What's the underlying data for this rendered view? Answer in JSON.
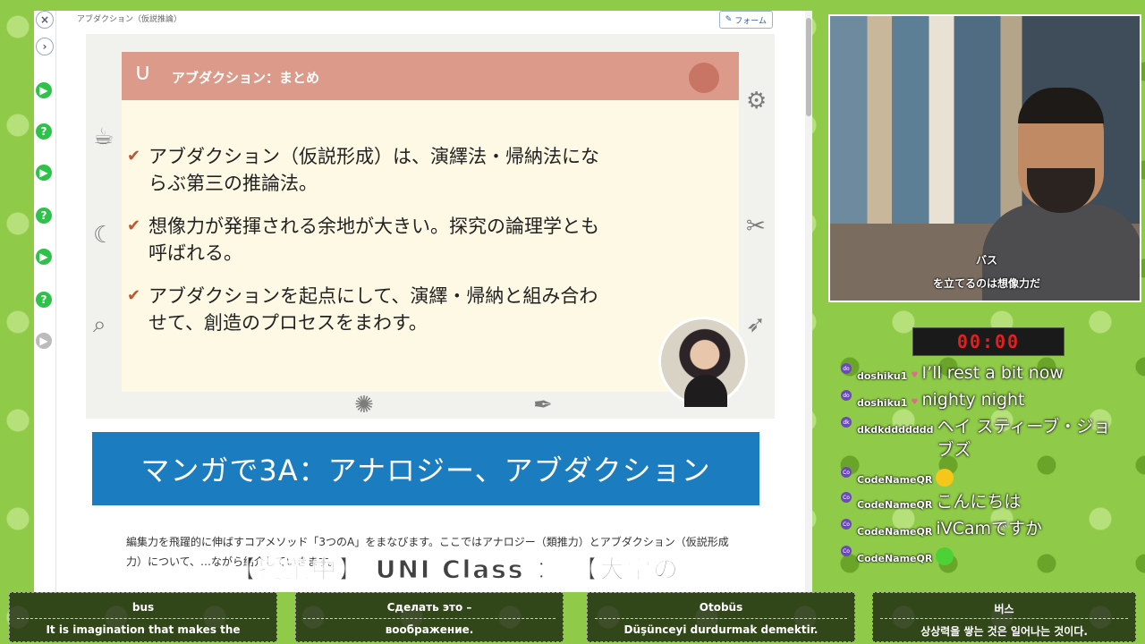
{
  "browser": {
    "breadcrumb": "アブダクション（仮説推論）",
    "form_button": "フォーム"
  },
  "slide": {
    "header": "アブダクション：まとめ",
    "bullets": [
      "アブダクション（仮説形成）は、演繹法・帰納法にならぶ第三の推論法。",
      "想像力が発揮される余地が大きい。探究の論理学とも呼ばれる。",
      "アブダクションを起点にして、演繹・帰納と組み合わせて、創造のプロセスをまわす。"
    ]
  },
  "banner": "マンガで3A：アナロジー、アブダクション",
  "paragraph": "編集力を飛躍的に伸ばすコアメソッド「3つのA」をまなびます。ここではアナロジー（類推力）とアブダクション（仮説形成力）について、…ながら紹介していきます。",
  "marquee": "【授業中】 UNI Class ： 【大学の",
  "webcam": {
    "caption_line1": "バス",
    "caption_line2": "を立てるのは想像力だ"
  },
  "timer": "00:00",
  "chat": [
    {
      "user": "doshiku1",
      "heart": true,
      "msg": "I’ll rest a bit now"
    },
    {
      "user": "doshiku1",
      "heart": true,
      "msg": "nighty night"
    },
    {
      "user": "dkdkddddddd",
      "heart": false,
      "msg": "ヘイ スティーブ・ジョブズ"
    },
    {
      "user": "CodeNameQR",
      "heart": false,
      "msg": "",
      "emoji": "#f5c71a"
    },
    {
      "user": "CodeNameQR",
      "heart": false,
      "msg": "こんにちは"
    },
    {
      "user": "CodeNameQR",
      "heart": false,
      "msg": "iVCamですか"
    },
    {
      "user": "CodeNameQR",
      "heart": false,
      "msg": "",
      "emoji": "#4cd137"
    }
  ],
  "subtitles": [
    {
      "l1": "bus",
      "l2": "It is imagination that makes the"
    },
    {
      "l1": "Сделать это –",
      "l2": "воображение."
    },
    {
      "l1": "Otobüs",
      "l2": "Düşünceyi durdurmak demektir."
    },
    {
      "l1": "버스",
      "l2": "상상력을 쌓는 것은 일어나는 것이다."
    }
  ]
}
